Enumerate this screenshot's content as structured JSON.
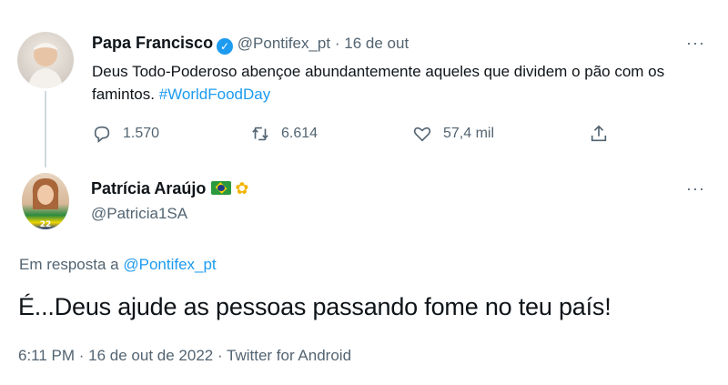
{
  "parent_tweet": {
    "author_name": "Papa Francisco",
    "verified_icon": "verified-badge-icon",
    "handle": "@Pontifex_pt",
    "separator": "·",
    "date": "16 de out",
    "text_main": "Deus Todo-Poderoso abençoe abundantemente aqueles que dividem o pão com os famintos.",
    "hashtag": "#WorldFoodDay",
    "replies": "1.570",
    "retweets": "6.614",
    "likes": "57,4 mil",
    "more": "···"
  },
  "reply_tweet": {
    "author_name": "Patrícia Araújo",
    "flag_emoji": "🇧🇷",
    "sunflower_emoji": "🌻",
    "handle": "@Patricia1SA",
    "more": "···",
    "in_reply_prefix": "Em resposta a",
    "in_reply_handle": "@Pontifex_pt",
    "text": "É...Deus ajude as pessoas passando fome no teu país!",
    "timestamp": "6:11 PM · 16 de out de 2022 · Twitter for Android"
  },
  "colors": {
    "accent": "#1d9bf0",
    "text": "#0f1419",
    "muted": "#536471"
  }
}
